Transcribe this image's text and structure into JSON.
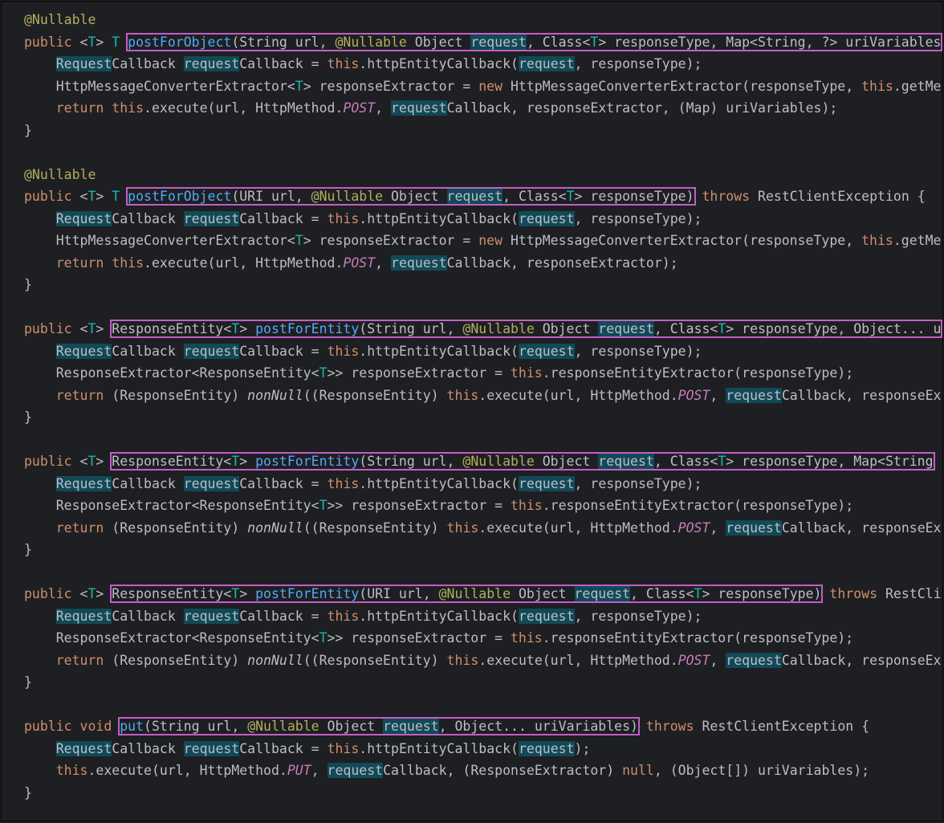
{
  "code_lines": [
    [
      {
        "t": "@Nullable",
        "c": "ann"
      }
    ],
    [
      {
        "t": "public",
        "c": "kw"
      },
      {
        "t": " <"
      },
      {
        "t": "T",
        "c": "tp"
      },
      {
        "t": "> "
      },
      {
        "t": "T",
        "c": "tp"
      },
      {
        "t": " "
      },
      {
        "t": "postForObject",
        "c": "fn",
        "box": "s"
      },
      {
        "t": "(String url, ",
        "box": "m"
      },
      {
        "t": "@Nullable",
        "c": "ann",
        "box": "m"
      },
      {
        "t": " Object ",
        "box": "m"
      },
      {
        "t": "request",
        "hl": true,
        "box": "m"
      },
      {
        "t": ", Class<",
        "box": "m"
      },
      {
        "t": "T",
        "c": "tp",
        "box": "m"
      },
      {
        "t": "> responseType, Map<String, ?> uriVariables",
        "box": "e"
      }
    ],
    [
      {
        "t": "    "
      },
      {
        "t": "Request",
        "hl": true
      },
      {
        "t": "Callback "
      },
      {
        "t": "request",
        "hl": true
      },
      {
        "t": "Callback = "
      },
      {
        "t": "this",
        "c": "kw"
      },
      {
        "t": ".httpEntityCallback("
      },
      {
        "t": "request",
        "hl": true
      },
      {
        "t": ", responseType);"
      }
    ],
    [
      {
        "t": "    HttpMessageConverterExtractor<"
      },
      {
        "t": "T",
        "c": "tp"
      },
      {
        "t": "> responseExtractor = "
      },
      {
        "t": "new",
        "c": "kw"
      },
      {
        "t": " HttpMessageConverterExtractor(responseType, "
      },
      {
        "t": "this",
        "c": "kw"
      },
      {
        "t": ".getMe"
      }
    ],
    [
      {
        "t": "    "
      },
      {
        "t": "return",
        "c": "kw"
      },
      {
        "t": " "
      },
      {
        "t": "this",
        "c": "kw"
      },
      {
        "t": ".execute(url, HttpMethod."
      },
      {
        "t": "POST",
        "c": "const"
      },
      {
        "t": ", "
      },
      {
        "t": "request",
        "hl": true
      },
      {
        "t": "Callback, responseExtractor, (Map) uriVariables);"
      }
    ],
    [
      {
        "t": "}"
      }
    ],
    [
      {
        "t": ""
      }
    ],
    [
      {
        "t": "@Nullable",
        "c": "ann"
      }
    ],
    [
      {
        "t": "public",
        "c": "kw"
      },
      {
        "t": " <"
      },
      {
        "t": "T",
        "c": "tp"
      },
      {
        "t": "> "
      },
      {
        "t": "T",
        "c": "tp"
      },
      {
        "t": " "
      },
      {
        "t": "postForObject",
        "c": "fn",
        "box": "s"
      },
      {
        "t": "(URI url, ",
        "box": "m"
      },
      {
        "t": "@Nullable",
        "c": "ann",
        "box": "m"
      },
      {
        "t": " Object ",
        "box": "m"
      },
      {
        "t": "request",
        "hl": true,
        "box": "m"
      },
      {
        "t": ", Class<",
        "box": "m"
      },
      {
        "t": "T",
        "c": "tp",
        "box": "m"
      },
      {
        "t": "> responseType)",
        "box": "e"
      },
      {
        "t": " "
      },
      {
        "t": "throws",
        "c": "kw"
      },
      {
        "t": " RestClientException {"
      }
    ],
    [
      {
        "t": "    "
      },
      {
        "t": "Request",
        "hl": true
      },
      {
        "t": "Callback "
      },
      {
        "t": "request",
        "hl": true
      },
      {
        "t": "Callback = "
      },
      {
        "t": "this",
        "c": "kw"
      },
      {
        "t": ".httpEntityCallback("
      },
      {
        "t": "request",
        "hl": true
      },
      {
        "t": ", responseType);"
      }
    ],
    [
      {
        "t": "    HttpMessageConverterExtractor<"
      },
      {
        "t": "T",
        "c": "tp"
      },
      {
        "t": "> responseExtractor = "
      },
      {
        "t": "new",
        "c": "kw"
      },
      {
        "t": " HttpMessageConverterExtractor(responseType, "
      },
      {
        "t": "this",
        "c": "kw"
      },
      {
        "t": ".getMe"
      }
    ],
    [
      {
        "t": "    "
      },
      {
        "t": "return",
        "c": "kw"
      },
      {
        "t": " "
      },
      {
        "t": "this",
        "c": "kw"
      },
      {
        "t": ".execute(url, HttpMethod."
      },
      {
        "t": "POST",
        "c": "const"
      },
      {
        "t": ", "
      },
      {
        "t": "request",
        "hl": true
      },
      {
        "t": "Callback, responseExtractor);"
      }
    ],
    [
      {
        "t": "}"
      }
    ],
    [
      {
        "t": ""
      }
    ],
    [
      {
        "t": "public",
        "c": "kw"
      },
      {
        "t": " <"
      },
      {
        "t": "T",
        "c": "tp"
      },
      {
        "t": "> "
      },
      {
        "t": "ResponseEntity<",
        "box": "s"
      },
      {
        "t": "T",
        "c": "tp",
        "box": "m"
      },
      {
        "t": "> ",
        "box": "m"
      },
      {
        "t": "postForEntity",
        "c": "fn",
        "box": "m"
      },
      {
        "t": "(String url, ",
        "box": "m"
      },
      {
        "t": "@Nullable",
        "c": "ann",
        "box": "m"
      },
      {
        "t": " Object ",
        "box": "m"
      },
      {
        "t": "request",
        "hl": true,
        "box": "m"
      },
      {
        "t": ", Class<",
        "box": "m"
      },
      {
        "t": "T",
        "c": "tp",
        "box": "m"
      },
      {
        "t": "> responseType, Object... u",
        "box": "e"
      }
    ],
    [
      {
        "t": "    "
      },
      {
        "t": "Request",
        "hl": true
      },
      {
        "t": "Callback "
      },
      {
        "t": "request",
        "hl": true
      },
      {
        "t": "Callback = "
      },
      {
        "t": "this",
        "c": "kw"
      },
      {
        "t": ".httpEntityCallback("
      },
      {
        "t": "request",
        "hl": true
      },
      {
        "t": ", responseType);"
      }
    ],
    [
      {
        "t": "    ResponseExtractor<ResponseEntity<"
      },
      {
        "t": "T",
        "c": "tp"
      },
      {
        "t": ">> responseExtractor = "
      },
      {
        "t": "this",
        "c": "kw"
      },
      {
        "t": ".responseEntityExtractor(responseType);"
      }
    ],
    [
      {
        "t": "    "
      },
      {
        "t": "return",
        "c": "kw"
      },
      {
        "t": " (ResponseEntity) "
      },
      {
        "t": "nonNull",
        "c": "it"
      },
      {
        "t": "((ResponseEntity) "
      },
      {
        "t": "this",
        "c": "kw"
      },
      {
        "t": ".execute(url, HttpMethod."
      },
      {
        "t": "POST",
        "c": "const"
      },
      {
        "t": ", "
      },
      {
        "t": "request",
        "hl": true
      },
      {
        "t": "Callback, responseEx"
      }
    ],
    [
      {
        "t": "}"
      }
    ],
    [
      {
        "t": ""
      }
    ],
    [
      {
        "t": "public",
        "c": "kw"
      },
      {
        "t": " <"
      },
      {
        "t": "T",
        "c": "tp"
      },
      {
        "t": "> "
      },
      {
        "t": "ResponseEntity<",
        "box": "s"
      },
      {
        "t": "T",
        "c": "tp",
        "box": "m"
      },
      {
        "t": "> ",
        "box": "m"
      },
      {
        "t": "postForEntity",
        "c": "fn",
        "box": "m"
      },
      {
        "t": "(String url, ",
        "box": "m"
      },
      {
        "t": "@Nullable",
        "c": "ann",
        "box": "m"
      },
      {
        "t": " Object ",
        "box": "m"
      },
      {
        "t": "request",
        "hl": true,
        "box": "m"
      },
      {
        "t": ", Class<",
        "box": "m"
      },
      {
        "t": "T",
        "c": "tp",
        "box": "m"
      },
      {
        "t": "> responseType, Map<String",
        "box": "e"
      }
    ],
    [
      {
        "t": "    "
      },
      {
        "t": "Request",
        "hl": true
      },
      {
        "t": "Callback "
      },
      {
        "t": "request",
        "hl": true
      },
      {
        "t": "Callback = "
      },
      {
        "t": "this",
        "c": "kw"
      },
      {
        "t": ".httpEntityCallback("
      },
      {
        "t": "request",
        "hl": true
      },
      {
        "t": ", responseType);"
      }
    ],
    [
      {
        "t": "    ResponseExtractor<ResponseEntity<"
      },
      {
        "t": "T",
        "c": "tp"
      },
      {
        "t": ">> responseExtractor = "
      },
      {
        "t": "this",
        "c": "kw"
      },
      {
        "t": ".responseEntityExtractor(responseType);"
      }
    ],
    [
      {
        "t": "    "
      },
      {
        "t": "return",
        "c": "kw"
      },
      {
        "t": " (ResponseEntity) "
      },
      {
        "t": "nonNull",
        "c": "it"
      },
      {
        "t": "((ResponseEntity) "
      },
      {
        "t": "this",
        "c": "kw"
      },
      {
        "t": ".execute(url, HttpMethod."
      },
      {
        "t": "POST",
        "c": "const"
      },
      {
        "t": ", "
      },
      {
        "t": "request",
        "hl": true
      },
      {
        "t": "Callback, responseEx"
      }
    ],
    [
      {
        "t": "}"
      }
    ],
    [
      {
        "t": ""
      }
    ],
    [
      {
        "t": "public",
        "c": "kw"
      },
      {
        "t": " <"
      },
      {
        "t": "T",
        "c": "tp"
      },
      {
        "t": "> "
      },
      {
        "t": "ResponseEntity<",
        "box": "s"
      },
      {
        "t": "T",
        "c": "tp",
        "box": "m"
      },
      {
        "t": "> ",
        "box": "m"
      },
      {
        "t": "postForEntity",
        "c": "fn",
        "box": "m"
      },
      {
        "t": "(URI url, ",
        "box": "m"
      },
      {
        "t": "@Nullable",
        "c": "ann",
        "box": "m"
      },
      {
        "t": " Object ",
        "box": "m"
      },
      {
        "t": "request",
        "hl": true,
        "box": "m"
      },
      {
        "t": ", Class<",
        "box": "m"
      },
      {
        "t": "T",
        "c": "tp",
        "box": "m"
      },
      {
        "t": "> responseType)",
        "box": "e"
      },
      {
        "t": " "
      },
      {
        "t": "throws",
        "c": "kw"
      },
      {
        "t": " RestCli"
      }
    ],
    [
      {
        "t": "    "
      },
      {
        "t": "Request",
        "hl": true
      },
      {
        "t": "Callback "
      },
      {
        "t": "request",
        "hl": true
      },
      {
        "t": "Callback = "
      },
      {
        "t": "this",
        "c": "kw"
      },
      {
        "t": ".httpEntityCallback("
      },
      {
        "t": "request",
        "hl": true
      },
      {
        "t": ", responseType);"
      }
    ],
    [
      {
        "t": "    ResponseExtractor<ResponseEntity<"
      },
      {
        "t": "T",
        "c": "tp"
      },
      {
        "t": ">> responseExtractor = "
      },
      {
        "t": "this",
        "c": "kw"
      },
      {
        "t": ".responseEntityExtractor(responseType);"
      }
    ],
    [
      {
        "t": "    "
      },
      {
        "t": "return",
        "c": "kw"
      },
      {
        "t": " (ResponseEntity) "
      },
      {
        "t": "nonNull",
        "c": "it"
      },
      {
        "t": "((ResponseEntity) "
      },
      {
        "t": "this",
        "c": "kw"
      },
      {
        "t": ".execute(url, HttpMethod."
      },
      {
        "t": "POST",
        "c": "const"
      },
      {
        "t": ", "
      },
      {
        "t": "request",
        "hl": true
      },
      {
        "t": "Callback, responseEx"
      }
    ],
    [
      {
        "t": "}"
      }
    ],
    [
      {
        "t": ""
      }
    ],
    [
      {
        "t": "public",
        "c": "kw"
      },
      {
        "t": " "
      },
      {
        "t": "void",
        "c": "kw"
      },
      {
        "t": " "
      },
      {
        "t": "put",
        "c": "fn",
        "box": "s"
      },
      {
        "t": "(String url, ",
        "box": "m"
      },
      {
        "t": "@Nullable",
        "c": "ann",
        "box": "m"
      },
      {
        "t": " Object ",
        "box": "m"
      },
      {
        "t": "request",
        "hl": true,
        "box": "m"
      },
      {
        "t": ", Object... uriVariables)",
        "box": "e"
      },
      {
        "t": " "
      },
      {
        "t": "throws",
        "c": "kw"
      },
      {
        "t": " RestClientException {"
      }
    ],
    [
      {
        "t": "    "
      },
      {
        "t": "Request",
        "hl": true
      },
      {
        "t": "Callback "
      },
      {
        "t": "request",
        "hl": true
      },
      {
        "t": "Callback = "
      },
      {
        "t": "this",
        "c": "kw"
      },
      {
        "t": ".httpEntityCallback("
      },
      {
        "t": "request",
        "hl": true
      },
      {
        "t": ");"
      }
    ],
    [
      {
        "t": "    "
      },
      {
        "t": "this",
        "c": "kw"
      },
      {
        "t": ".execute(url, HttpMethod."
      },
      {
        "t": "PUT",
        "c": "const"
      },
      {
        "t": ", "
      },
      {
        "t": "request",
        "hl": true
      },
      {
        "t": "Callback, (ResponseExtractor) "
      },
      {
        "t": "null",
        "c": "kw"
      },
      {
        "t": ", (Object[]) uriVariables);"
      }
    ],
    [
      {
        "t": "}"
      }
    ]
  ]
}
